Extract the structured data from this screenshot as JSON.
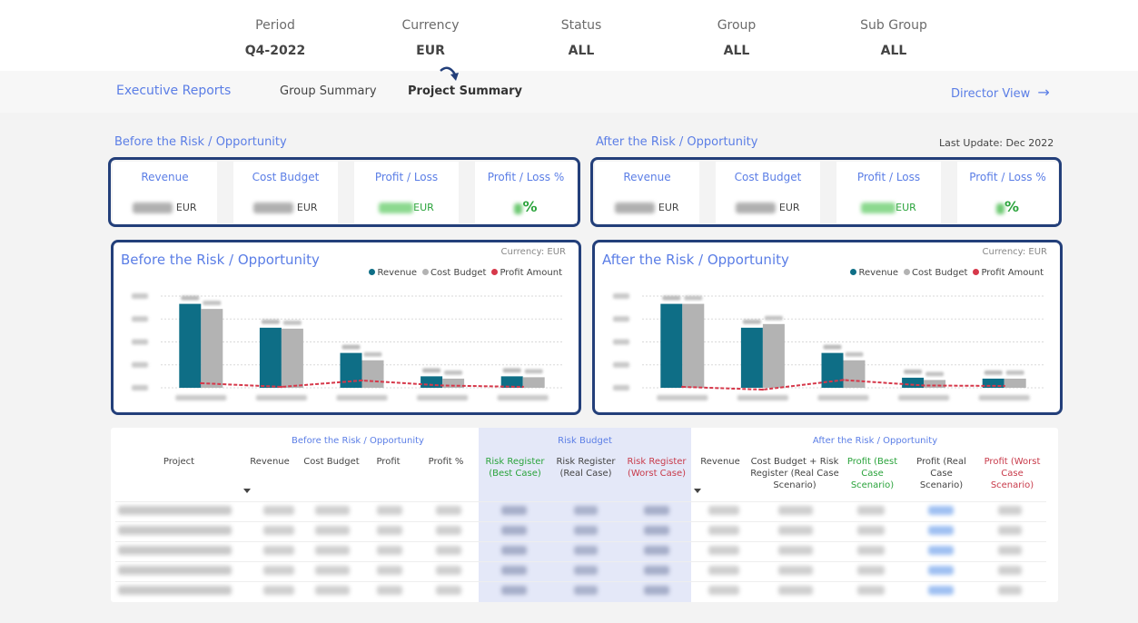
{
  "filters": [
    {
      "label": "Period",
      "value": "Q4-2022"
    },
    {
      "label": "Currency",
      "value": "EUR"
    },
    {
      "label": "Status",
      "value": "ALL"
    },
    {
      "label": "Group",
      "value": "ALL"
    },
    {
      "label": "Sub Group",
      "value": "ALL"
    }
  ],
  "nav": {
    "executive": "Executive Reports",
    "group_summary": "Group Summary",
    "project_summary": "Project Summary",
    "director_view": "Director View",
    "arrow": "→"
  },
  "sections": {
    "before": "Before the Risk / Opportunity",
    "after": "After the Risk / Opportunity",
    "last_update": "Last Update: Dec 2022"
  },
  "kpis": {
    "revenue": "Revenue",
    "cost_budget": "Cost Budget",
    "profit_loss": "Profit / Loss",
    "profit_loss_pct": "Profit / Loss %",
    "unit": "EUR",
    "pct_symbol": "%"
  },
  "charts": {
    "before_title": "Before the Risk / Opportunity",
    "after_title": "After the Risk / Opportunity",
    "currency": "Currency: EUR",
    "legend": [
      "Revenue",
      "Cost Budget",
      "Profit Amount"
    ],
    "colors": {
      "revenue": "#0e6e86",
      "cost": "#b3b3b3",
      "profit": "#d6384a"
    }
  },
  "chart_data": [
    {
      "type": "bar",
      "title": "Before the Risk / Opportunity",
      "categories": [
        "",
        "",
        "",
        "",
        ""
      ],
      "series": [
        {
          "name": "Revenue",
          "values": [
            183,
            131,
            76,
            25,
            25
          ]
        },
        {
          "name": "Cost Budget",
          "values": [
            172,
            129,
            60,
            20,
            23
          ]
        },
        {
          "name": "Profit Amount",
          "values": [
            10,
            2,
            16,
            5,
            2
          ]
        }
      ],
      "ylim": [
        0,
        200
      ]
    },
    {
      "type": "bar",
      "title": "After the Risk / Opportunity",
      "categories": [
        "",
        "",
        "",
        "",
        ""
      ],
      "series": [
        {
          "name": "Revenue",
          "values": [
            183,
            131,
            76,
            22,
            20
          ]
        },
        {
          "name": "Cost Budget",
          "values": [
            183,
            139,
            60,
            17,
            20
          ]
        },
        {
          "name": "Profit Amount",
          "values": [
            2,
            -4,
            17,
            5,
            4
          ]
        }
      ],
      "ylim": [
        0,
        200
      ]
    }
  ],
  "table": {
    "group_before": "Before the Risk / Opportunity",
    "group_risk": "Risk Budget",
    "group_after": "After the Risk / Opportunity",
    "headers": {
      "project": "Project",
      "revenue": "Revenue",
      "cost_budget": "Cost Budget",
      "profit": "Profit",
      "profit_pct": "Profit %",
      "rr_best": "Risk Register (Best Case)",
      "rr_real": "Risk Register (Real Case)",
      "rr_worst": "Risk Register (Worst Case)",
      "revenue2": "Revenue",
      "cost_rr": "Cost Budget + Risk Register (Real Case Scenario)",
      "profit_best": "Profit (Best Case Scenario)",
      "profit_real": "Profit (Real Case Scenario)",
      "profit_worst": "Profit (Worst Case Scenario)"
    },
    "header_colors": {
      "best": "#2aa33b",
      "worst": "#c83a4a",
      "real_value": "#5b8ff0"
    },
    "row_count": 5
  }
}
